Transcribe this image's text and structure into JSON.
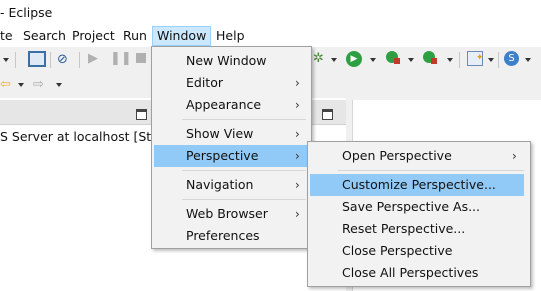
{
  "window": {
    "title": "- Eclipse"
  },
  "menubar": {
    "items": [
      {
        "label": "te"
      },
      {
        "label": "Search"
      },
      {
        "label": "Project"
      },
      {
        "label": "Run"
      },
      {
        "label": "Window"
      },
      {
        "label": "Help"
      }
    ]
  },
  "servers_view": {
    "row_text": "S Server at localhost  [Stoppe"
  },
  "window_menu": {
    "items": [
      {
        "label": "New Window"
      },
      {
        "label": "Editor"
      },
      {
        "label": "Appearance"
      },
      {
        "label": "Show View"
      },
      {
        "label": "Perspective"
      },
      {
        "label": "Navigation"
      },
      {
        "label": "Web Browser"
      },
      {
        "label": "Preferences"
      }
    ]
  },
  "perspective_menu": {
    "items": [
      {
        "label": "Open Perspective"
      },
      {
        "label": "Customize Perspective..."
      },
      {
        "label": "Save Perspective As..."
      },
      {
        "label": "Reset Perspective..."
      },
      {
        "label": "Close Perspective"
      },
      {
        "label": "Close All Perspectives"
      }
    ]
  },
  "colors": {
    "menu_highlight": "#91c9f7",
    "menubar_open": "#cce8ff",
    "menu_bg": "#f2f2f2"
  }
}
